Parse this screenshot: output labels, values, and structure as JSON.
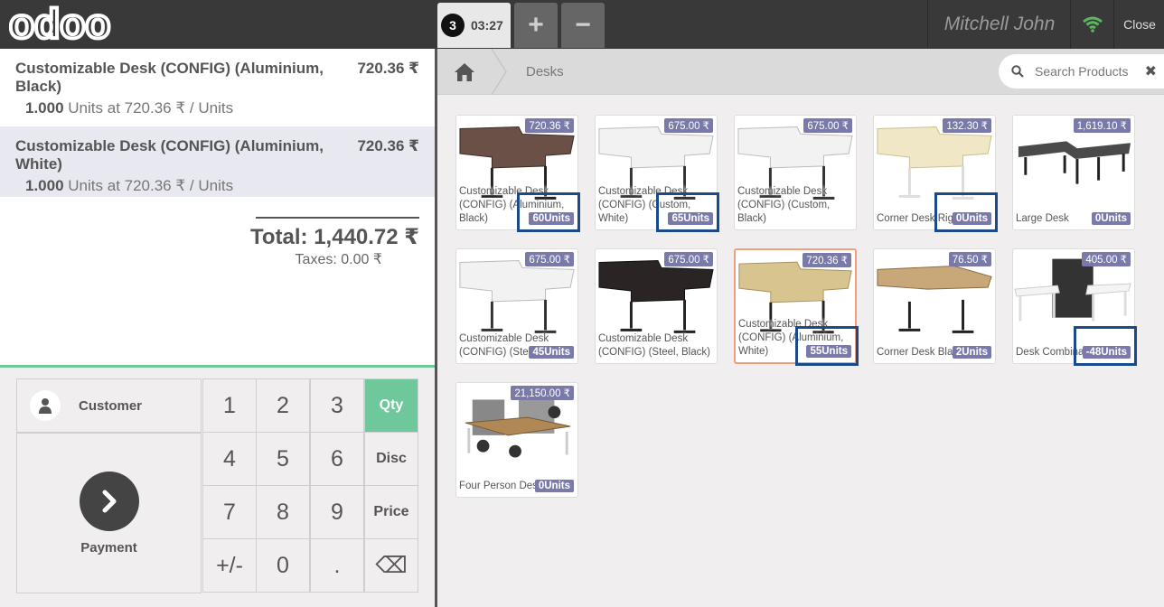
{
  "header": {
    "logo_text": "odoo",
    "order_number": "3",
    "order_time": "03:27",
    "add_symbol": "+",
    "remove_symbol": "−",
    "user_name": "Mitchell John",
    "close_label": "Close"
  },
  "order": {
    "lines": [
      {
        "name": "Customizable Desk (CONFIG) (Aluminium, Black)",
        "price": "720.36 ₹",
        "qty": "1.000",
        "info": "Units at 720.36 ₹ / Units",
        "selected": false
      },
      {
        "name": "Customizable Desk (CONFIG) (Aluminium, White)",
        "price": "720.36 ₹",
        "qty": "1.000",
        "info": "Units at 720.36 ₹ / Units",
        "selected": true
      }
    ],
    "total": "Total: 1,440.72 ₹",
    "taxes": "Taxes: 0.00 ₹"
  },
  "pad": {
    "customer_label": "Customer",
    "payment_label": "Payment",
    "keys": [
      "1",
      "2",
      "3",
      "Qty",
      "4",
      "5",
      "6",
      "Disc",
      "7",
      "8",
      "9",
      "Price",
      "+/-",
      "0",
      ".",
      "⌫"
    ],
    "active_mode": "Qty"
  },
  "products_header": {
    "breadcrumb": "Desks",
    "search_placeholder": "Search Products"
  },
  "products": [
    {
      "name": "Customizable Desk (CONFIG) (Aluminium, Black)",
      "price": "720.36 ₹",
      "stock": "60Units",
      "img": "desk-dark-top",
      "boxed": true
    },
    {
      "name": "Customizable Desk (CONFIG) (Custom, White)",
      "price": "675.00 ₹",
      "stock": "65Units",
      "img": "desk-white-top",
      "boxed": true
    },
    {
      "name": "Customizable Desk (CONFIG) (Custom, Black)",
      "price": "675.00 ₹",
      "stock": "",
      "img": "desk-white-top",
      "boxed": false
    },
    {
      "name": "Corner Desk Right Sit",
      "price": "132.30 ₹",
      "stock": "0Units",
      "img": "desk-light-corner",
      "boxed": true
    },
    {
      "name": "Large Desk",
      "price": "1,619.10 ₹",
      "stock": "0Units",
      "img": "desk-large",
      "boxed": false
    },
    {
      "name": "Customizable Desk (CONFIG) (Steel, White)",
      "price": "675.00 ₹",
      "stock": "45Units",
      "img": "desk-white-top",
      "boxed": false
    },
    {
      "name": "Customizable Desk (CONFIG) (Steel, Black)",
      "price": "675.00 ₹",
      "stock": "",
      "img": "desk-black-top",
      "boxed": false
    },
    {
      "name": "Customizable Desk (CONFIG) (Aluminium, White)",
      "price": "720.36 ₹",
      "stock": "55Units",
      "img": "desk-wood-top",
      "boxed": true,
      "highlight": true
    },
    {
      "name": "Corner Desk Black",
      "price": "76.50 ₹",
      "stock": "2Units",
      "img": "desk-wood-corner",
      "boxed": false
    },
    {
      "name": "Desk Combination",
      "price": "405.00 ₹",
      "stock": "-48Units",
      "img": "desk-combo",
      "boxed": true
    },
    {
      "name": "Four Person Desk",
      "price": "21,150.00 ₹",
      "stock": "0Units",
      "img": "office-cubicle",
      "boxed": false
    }
  ],
  "colors": {
    "topbar": "#393939",
    "accent_green": "#6ec89b",
    "badge": "#7a7aaa",
    "highlight_box": "#1a4a8a"
  }
}
